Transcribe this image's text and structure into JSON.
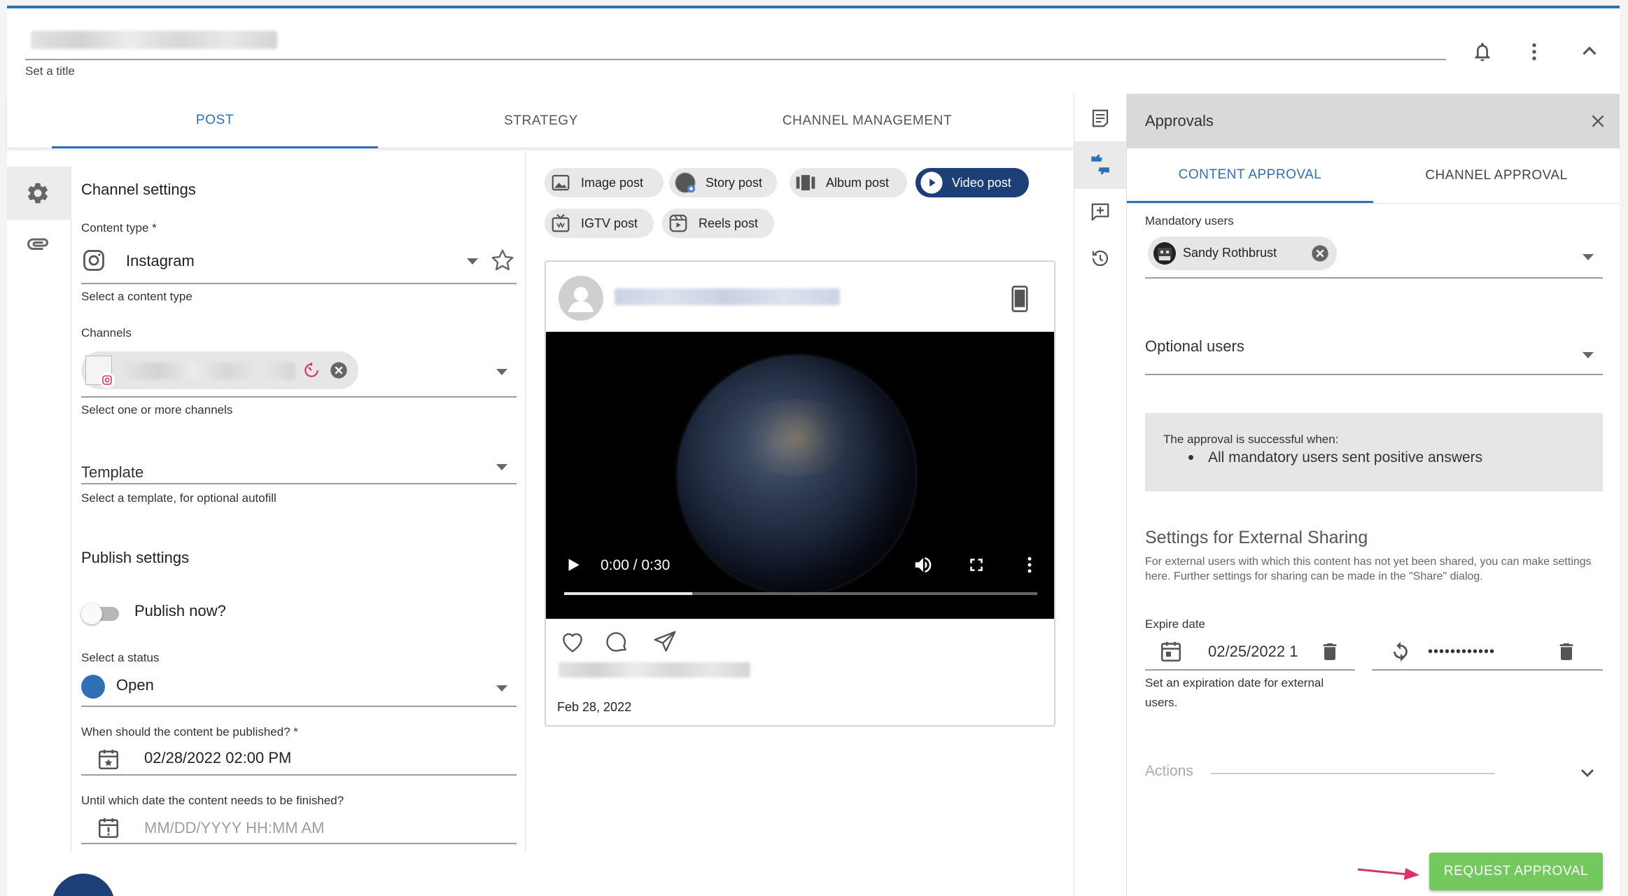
{
  "header": {
    "title_hint": "Set a title"
  },
  "tabs": [
    {
      "label": "POST",
      "active": true
    },
    {
      "label": "STRATEGY",
      "active": false
    },
    {
      "label": "CHANNEL MANAGEMENT",
      "active": false
    }
  ],
  "channel_settings": {
    "title": "Channel settings",
    "content_type_label": "Content type *",
    "content_type_value": "Instagram",
    "content_type_hint": "Select a content type",
    "channels_label": "Channels",
    "channels_hint": "Select one or more channels",
    "template_label": "Template",
    "template_hint": "Select a template, for optional autofill"
  },
  "publish_settings": {
    "title": "Publish settings",
    "publish_now_label": "Publish now?",
    "status_label": "Select a status",
    "status_value": "Open",
    "status_color": "#2f6fb5",
    "publish_date_label": "When should the content be published? *",
    "publish_date_value": "02/28/2022 02:00 PM",
    "finish_date_label": "Until which date the content needs to be finished?",
    "finish_date_placeholder": "MM/DD/YYYY HH:MM AM"
  },
  "post_types": [
    {
      "label": "Image post",
      "icon": "image-icon"
    },
    {
      "label": "Story post",
      "icon": "story-icon"
    },
    {
      "label": "Album post",
      "icon": "album-icon"
    },
    {
      "label": "Video post",
      "icon": "play-icon",
      "active": true
    },
    {
      "label": "IGTV post",
      "icon": "tv-icon"
    },
    {
      "label": "Reels post",
      "icon": "reels-icon"
    }
  ],
  "preview": {
    "time": "0:00 / 0:30",
    "date": "Feb 28, 2022",
    "progress": 0.27
  },
  "approvals": {
    "title": "Approvals",
    "tabs": [
      {
        "label": "CONTENT APPROVAL",
        "active": true
      },
      {
        "label": "CHANNEL APPROVAL",
        "active": false
      }
    ],
    "mandatory_label": "Mandatory users",
    "mandatory_user": "Sandy Rothbrust",
    "optional_label": "Optional users",
    "info_title": "The approval is successful when:",
    "info_item": "All mandatory users sent positive answers",
    "sharing_title": "Settings for External Sharing",
    "sharing_desc": "For external users with which this content has not yet been shared, you can make settings here. Further settings for sharing can be made in the \"Share\" dialog.",
    "expire_label": "Expire date",
    "expire_value": "02/25/2022 1",
    "password_value": "••••••••••••",
    "expire_hint": "Set an expiration date for external users.",
    "actions_label": "Actions",
    "request_button": "REQUEST APPROVAL"
  },
  "colors": {
    "accent": "#2f6fb5",
    "navy": "#1c3f78",
    "success": "#73c95d",
    "arrow": "#d6336c"
  }
}
